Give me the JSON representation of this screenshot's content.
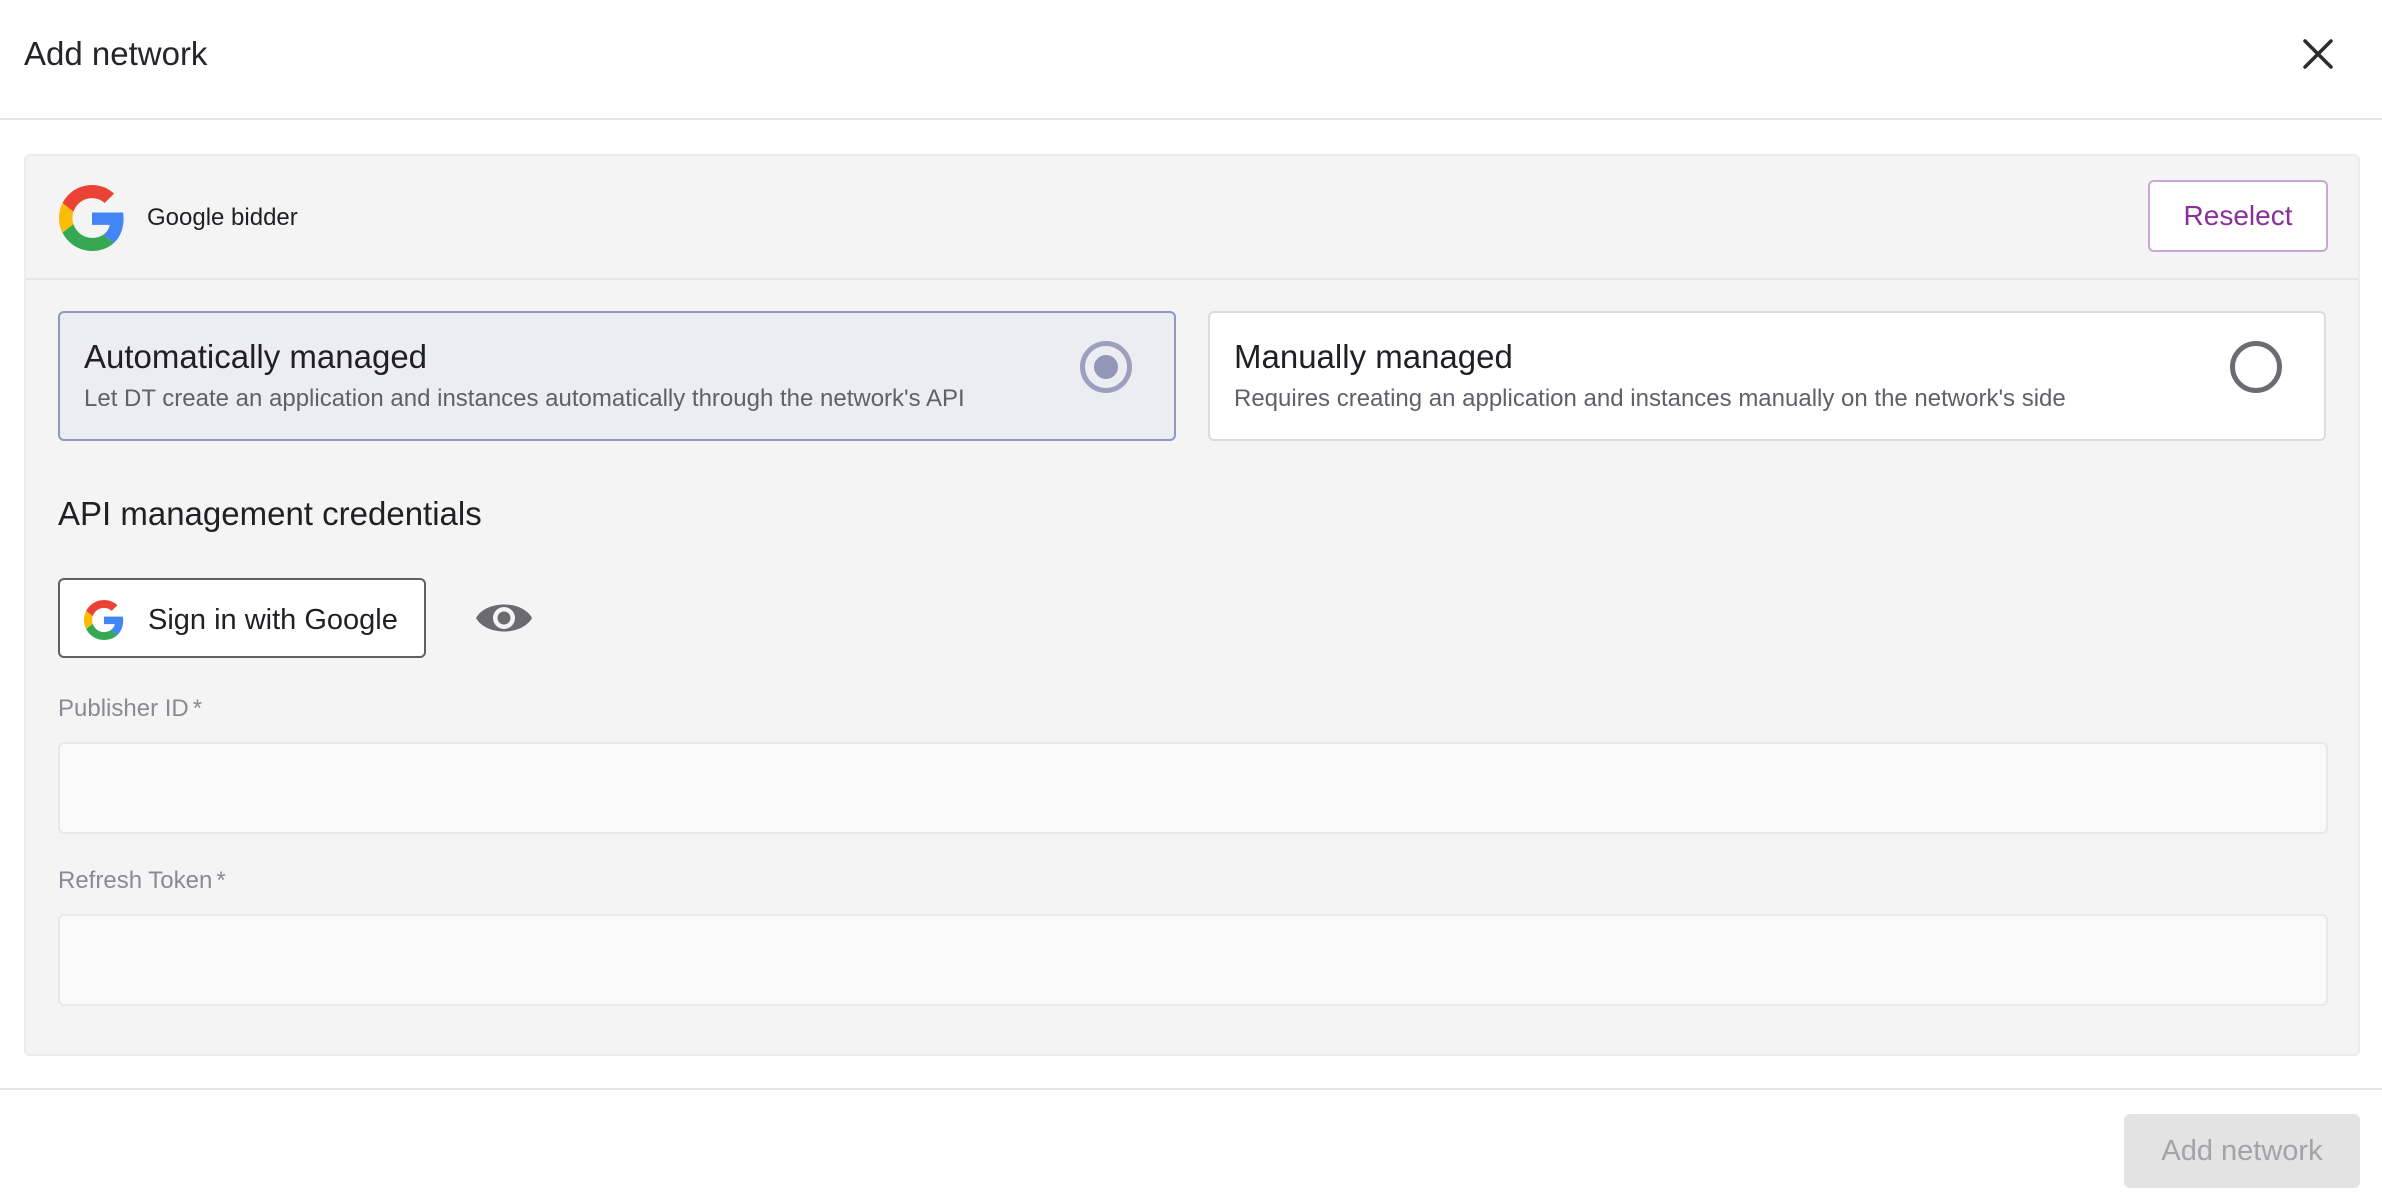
{
  "dialog": {
    "title": "Add network",
    "close_icon": "close-icon"
  },
  "network": {
    "name": "Google bidder",
    "logo_icon": "google-logo-icon",
    "reselect_label": "Reselect",
    "brand_colors": {
      "blue": "#4285F4",
      "red": "#EA4335",
      "yellow": "#FBBC05",
      "green": "#34A853"
    }
  },
  "management": {
    "options": [
      {
        "title": "Automatically managed",
        "description": "Let DT create an application and instances automatically through the network's API",
        "selected": true
      },
      {
        "title": "Manually managed",
        "description": "Requires creating an application and instances manually on the network's side",
        "selected": false
      }
    ]
  },
  "credentials": {
    "section_title": "API management credentials",
    "signin_label": "Sign in with Google",
    "visibility_icon": "eye-icon",
    "fields": {
      "publisher_id": {
        "label": "Publisher ID",
        "required_mark": "*",
        "value": "",
        "placeholder": ""
      },
      "refresh_token": {
        "label": "Refresh Token",
        "required_mark": "*",
        "value": "",
        "placeholder": ""
      }
    }
  },
  "footer": {
    "add_network_label": "Add network",
    "disabled": true
  },
  "colors": {
    "accent_purple": "#8A2F9A",
    "selected_border": "#9497C1",
    "selected_background": "#ECEDF3",
    "panel_background": "#F4F4F4",
    "disabled_button": "#E3E3E3"
  }
}
